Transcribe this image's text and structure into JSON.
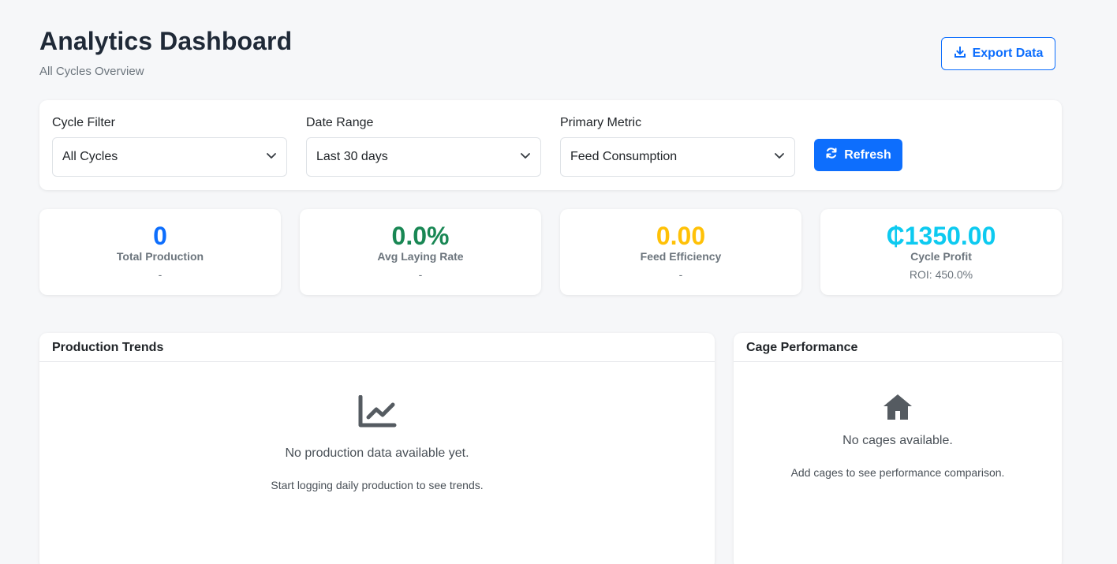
{
  "header": {
    "title": "Analytics Dashboard",
    "subtitle": "All Cycles Overview",
    "export_label": "Export Data"
  },
  "filters": {
    "cycle": {
      "label": "Cycle Filter",
      "value": "All Cycles"
    },
    "date_range": {
      "label": "Date Range",
      "value": "Last 30 days"
    },
    "metric": {
      "label": "Primary Metric",
      "value": "Feed Consumption"
    },
    "refresh_label": "Refresh"
  },
  "stats": [
    {
      "value": "0",
      "label": "Total Production",
      "sub": "-",
      "color": "#0d6efd"
    },
    {
      "value": "0.0%",
      "label": "Avg Laying Rate",
      "sub": "-",
      "color": "#198754"
    },
    {
      "value": "0.00",
      "label": "Feed Efficiency",
      "sub": "-",
      "color": "#ffc107"
    },
    {
      "value": "₵1350.00",
      "label": "Cycle Profit",
      "sub": "ROI: 450.0%",
      "color": "#0dcaf0"
    }
  ],
  "production_trends": {
    "title": "Production Trends",
    "icon": "chart-line-icon",
    "empty_text": "No production data available yet.",
    "hint_text": "Start logging daily production to see trends."
  },
  "cage_performance": {
    "title": "Cage Performance",
    "icon": "home-icon",
    "empty_text": "No cages available.",
    "hint_text": "Add cages to see performance comparison."
  }
}
